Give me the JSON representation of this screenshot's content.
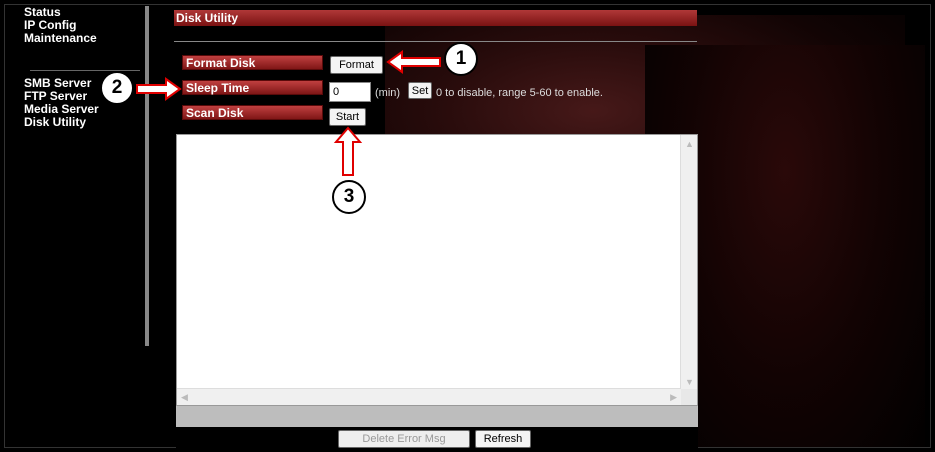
{
  "sidebar": {
    "items_top": [
      {
        "label": "Status"
      },
      {
        "label": "IP Config"
      },
      {
        "label": "Maintenance"
      }
    ],
    "items_bottom": [
      {
        "label": "SMB Server"
      },
      {
        "label": "FTP Server"
      },
      {
        "label": "Media Server"
      },
      {
        "label": "Disk Utility"
      }
    ]
  },
  "page": {
    "title": "Disk Utility"
  },
  "format_row": {
    "label": "Format Disk",
    "button": "Format"
  },
  "sleep_row": {
    "label": "Sleep Time",
    "value": "0",
    "unit": "(min)",
    "set_button": "Set",
    "hint": "0 to disable, range 5-60 to enable."
  },
  "scan_row": {
    "label": "Scan Disk",
    "button": "Start"
  },
  "log": {
    "value": ""
  },
  "footer": {
    "delete_button": "Delete Error Msg",
    "refresh_button": "Refresh"
  },
  "callouts": [
    {
      "number": "1"
    },
    {
      "number": "2"
    },
    {
      "number": "3"
    }
  ],
  "colors": {
    "accent": "#b03838",
    "callout_arrow": "#e00000"
  }
}
